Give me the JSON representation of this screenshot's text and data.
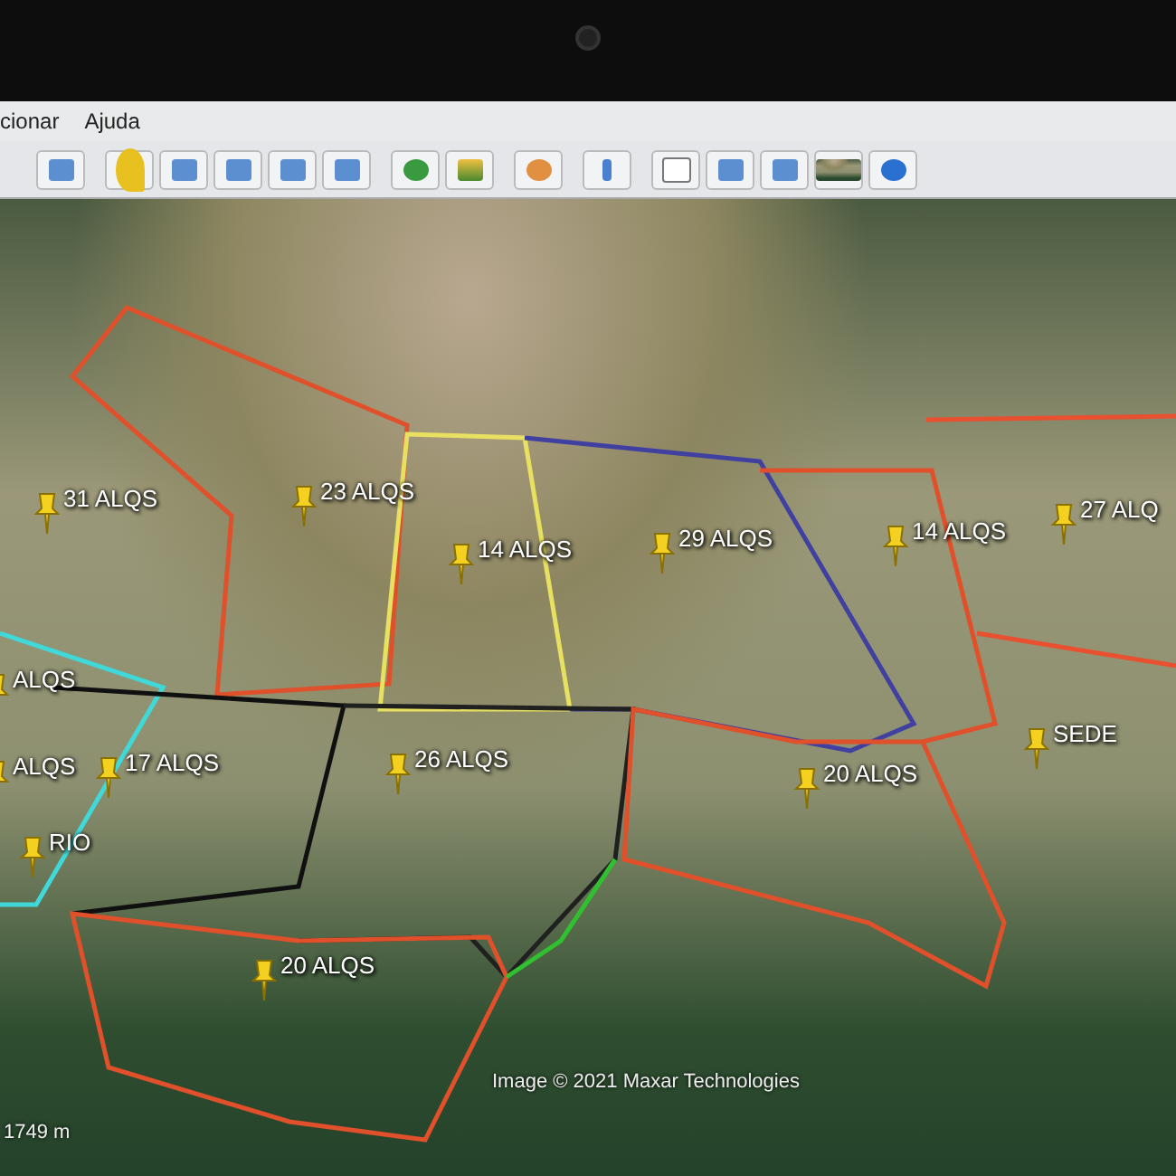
{
  "menu_bar": {
    "items": [
      "cionar",
      "Ajuda"
    ]
  },
  "map": {
    "placemarks": [
      {
        "label": "31 ALQS"
      },
      {
        "label": "23 ALQS"
      },
      {
        "label": "14 ALQS"
      },
      {
        "label": "29 ALQS"
      },
      {
        "label": "14 ALQS"
      },
      {
        "label": "27 ALQ"
      },
      {
        "label": "ALQS"
      },
      {
        "label": "ALQS"
      },
      {
        "label": "17 ALQS"
      },
      {
        "label": "26 ALQS"
      },
      {
        "label": "20 ALQS"
      },
      {
        "label": "SEDE"
      },
      {
        "label": "RIO"
      },
      {
        "label": "20 ALQS"
      }
    ],
    "attribution": "Image © 2021 Maxar Technologies",
    "scale": "1749 m"
  }
}
